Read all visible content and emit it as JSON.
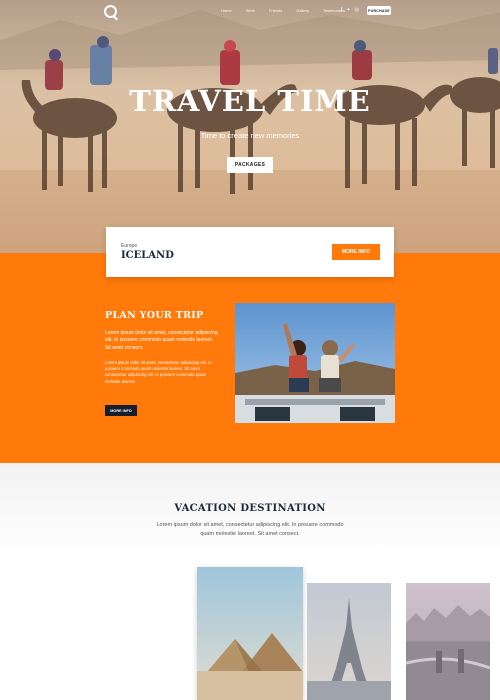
{
  "header": {
    "nav": [
      "Home",
      "Work",
      "Friends",
      "Gallery",
      "Testimonials"
    ],
    "purchase_label": "PURCHASE",
    "social_icons": [
      "facebook-icon",
      "twitter-icon",
      "instagram-icon"
    ]
  },
  "hero": {
    "title": "TRAVEL TIME",
    "subtitle": "Time to create new memories",
    "cta_label": "PACKAGES"
  },
  "destination_card": {
    "region": "Europe",
    "destination": "ICELAND",
    "button_label": "MORE INFO"
  },
  "plan": {
    "title": "PLAN YOUR TRIP",
    "paragraph1": "Lorem ipsum dolor sit amet, consectetur adipiscing elit. In posuere commodo quam molestie laoreet. Sit amet consect.",
    "paragraph2": "Lorem ipsum dolor sit amet, consectetur adipiscing elit. In posuere commodo quam molestie laoreet. Sit amet consectetur adipiscing elit. In posuere commodo quam molestie laoreet.",
    "button_label": "MORE INFO"
  },
  "vacation": {
    "title": "VACATION DESTINATION",
    "text": "Lorem ipsum dolor sit amet, consectetur adipiscing elit. In posuere commodo quam molestie laoreet. Sit amet consect."
  },
  "colors": {
    "accent": "#ff7a0a",
    "dark": "#15202c"
  }
}
